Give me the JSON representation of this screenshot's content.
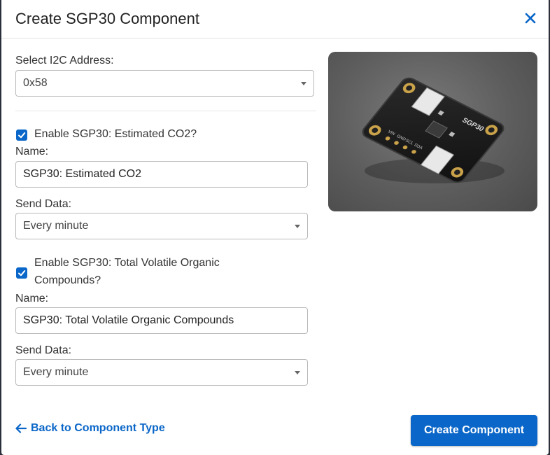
{
  "dialog": {
    "title": "Create SGP30 Component"
  },
  "address": {
    "label": "Select I2C Address:",
    "value": "0x58"
  },
  "co2": {
    "enable_label": "Enable SGP30: Estimated CO2?",
    "checked": true,
    "name_label": "Name:",
    "name_value": "SGP30: Estimated CO2",
    "send_label": "Send Data:",
    "send_value": "Every minute"
  },
  "tvoc": {
    "enable_label_line1": "Enable SGP30: Total Volatile Organic",
    "enable_label_line2": "Compounds?",
    "checked": true,
    "name_label": "Name:",
    "name_value": "SGP30: Total Volatile Organic Compounds",
    "send_label": "Send Data:",
    "send_value": "Every minute"
  },
  "board": {
    "chip_label": "SGP30",
    "pin_labels": [
      "VIN",
      "GND",
      "SCL",
      "SDA"
    ]
  },
  "footer": {
    "back_label": "Back to Component Type",
    "create_label": "Create Component"
  },
  "colors": {
    "accent": "#0a66c8"
  },
  "icons": {
    "close": "close-icon",
    "back": "arrow-left-icon",
    "caret": "chevron-down-icon",
    "check": "checkmark-icon"
  }
}
